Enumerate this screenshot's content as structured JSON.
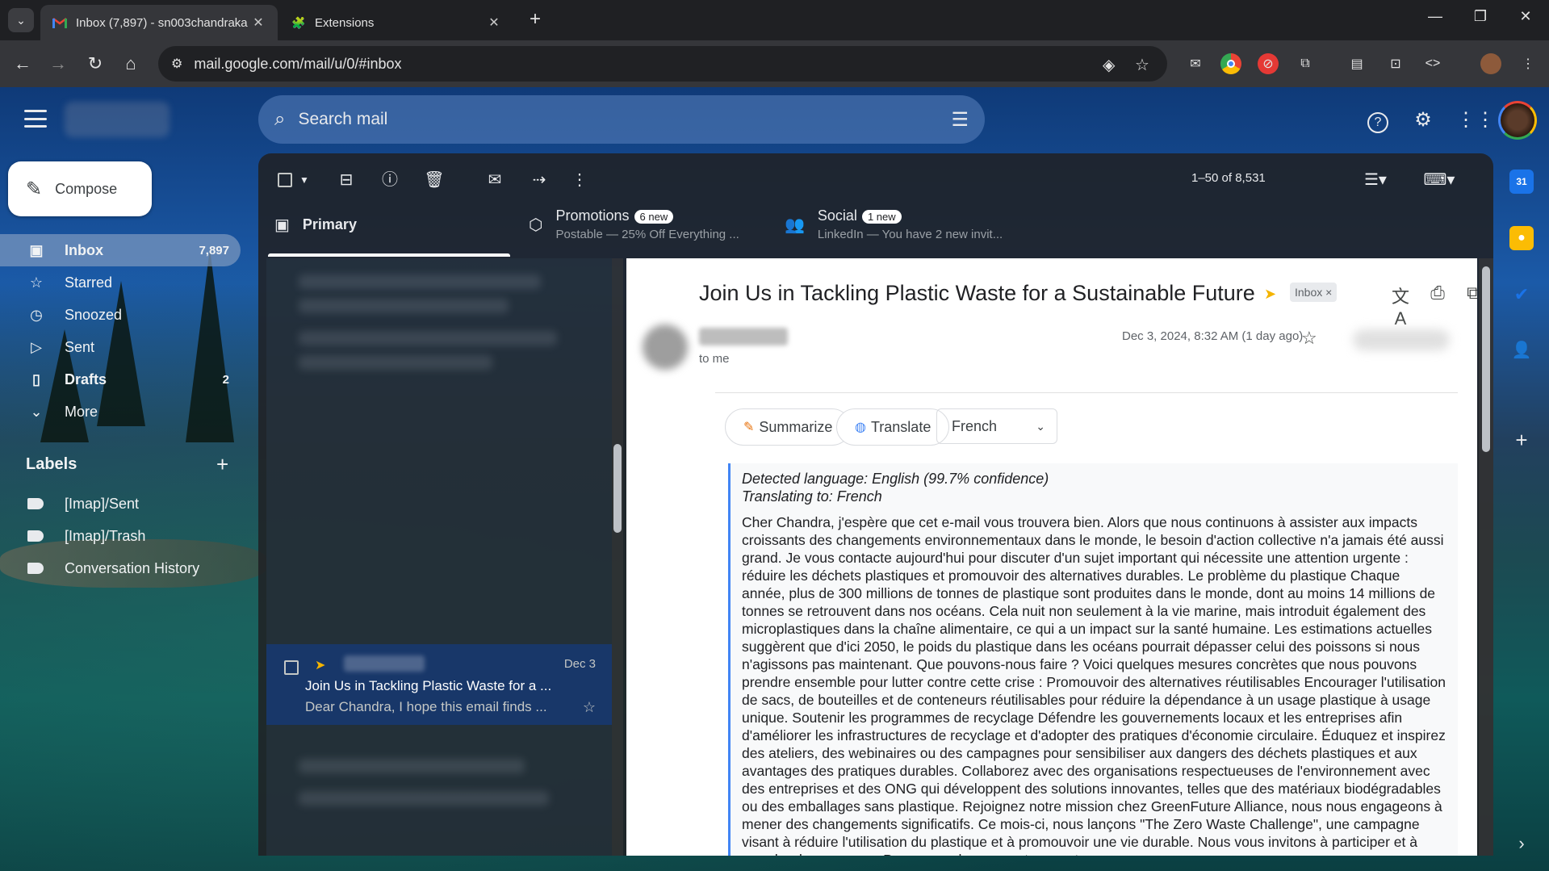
{
  "browser": {
    "tabs": [
      {
        "title": "Inbox (7,897) - sn003chandraka",
        "active": true
      },
      {
        "title": "Extensions",
        "active": false
      }
    ],
    "url": "mail.google.com/mail/u/0/#inbox"
  },
  "gmail": {
    "search_placeholder": "Search mail",
    "compose_label": "Compose",
    "nav": [
      {
        "label": "Inbox",
        "count": "7,897",
        "icon": "inbox-icon"
      },
      {
        "label": "Starred",
        "count": "",
        "icon": "star-icon"
      },
      {
        "label": "Snoozed",
        "count": "",
        "icon": "clock-icon"
      },
      {
        "label": "Sent",
        "count": "",
        "icon": "send-icon"
      },
      {
        "label": "Drafts",
        "count": "2",
        "icon": "draft-icon"
      },
      {
        "label": "More",
        "count": "",
        "icon": "chevron-down-icon"
      }
    ],
    "labels_header": "Labels",
    "labels": [
      "[Imap]/Sent",
      "[Imap]/Trash",
      "Conversation History"
    ],
    "page_count": "1–50 of 8,531",
    "categories": {
      "primary": {
        "label": "Primary"
      },
      "promotions": {
        "label": "Promotions",
        "badge": "6 new",
        "snippet": "Postable — 25% Off Everything ..."
      },
      "social": {
        "label": "Social",
        "badge": "1 new",
        "snippet": "LinkedIn — You have 2 new invit..."
      }
    },
    "selected_email": {
      "date": "Dec 3",
      "subject": "Join Us in Tackling Plastic Waste for a ...",
      "snippet": "Dear Chandra, I hope this email finds ..."
    },
    "message": {
      "subject": "Join Us in Tackling Plastic Waste for a Sustainable Future",
      "label_chip": "Inbox",
      "to": "to me",
      "date": "Dec 3, 2024, 8:32 AM (1 day ago)"
    },
    "extension": {
      "summarize_label": "Summarize",
      "translate_label": "Translate",
      "language_selected": "French",
      "detected": "Detected language: English (99.7% confidence)",
      "translating_to": "Translating to: French",
      "translation": "Cher Chandra, j'espère que cet e-mail vous trouvera bien. Alors que nous continuons à assister aux impacts croissants des changements environnementaux dans le monde, le besoin d'action collective n'a jamais été aussi grand. Je vous contacte aujourd'hui pour discuter d'un sujet important qui nécessite une attention urgente : réduire les déchets plastiques et promouvoir des alternatives durables. Le problème du plastique Chaque année, plus de 300 millions de tonnes de plastique sont produites dans le monde, dont au moins 14 millions de tonnes se retrouvent dans nos océans. Cela nuit non seulement à la vie marine, mais introduit également des microplastiques dans la chaîne alimentaire, ce qui a un impact sur la santé humaine. Les estimations actuelles suggèrent que d'ici 2050, le poids du plastique dans les océans pourrait dépasser celui des poissons si nous n'agissons pas maintenant. Que pouvons-nous faire ? Voici quelques mesures concrètes que nous pouvons prendre ensemble pour lutter contre cette crise : Promouvoir des alternatives réutilisables Encourager l'utilisation de sacs, de bouteilles et de conteneurs réutilisables pour réduire la dépendance à un usage plastique à usage unique. Soutenir les programmes de recyclage Défendre les gouvernements locaux et les entreprises afin d'améliorer les infrastructures de recyclage et d'adopter des pratiques d'économie circulaire. Éduquez et inspirez des ateliers, des webinaires ou des campagnes pour sensibiliser aux dangers des déchets plastiques et aux avantages des pratiques durables. Collaborez avec des organisations respectueuses de l'environnement avec des entreprises et des ONG qui développent des solutions innovantes, telles que des matériaux biodégradables ou des emballages sans plastique. Rejoignez notre mission chez GreenFuture Alliance, nous nous engageons à mener des changements significatifs. Ce mois-ci, nous lançons \"The Zero Waste Challenge\", une campagne visant à réduire l'utilisation du plastique et à promouvoir une vie durable. Nous vous invitons à participer et à prendre des mesures. Parce que chaque geste compte."
    }
  },
  "colors": {
    "accent_blue": "#4285f4",
    "important_yellow": "#f4b400",
    "selected_row": "#18386e"
  }
}
